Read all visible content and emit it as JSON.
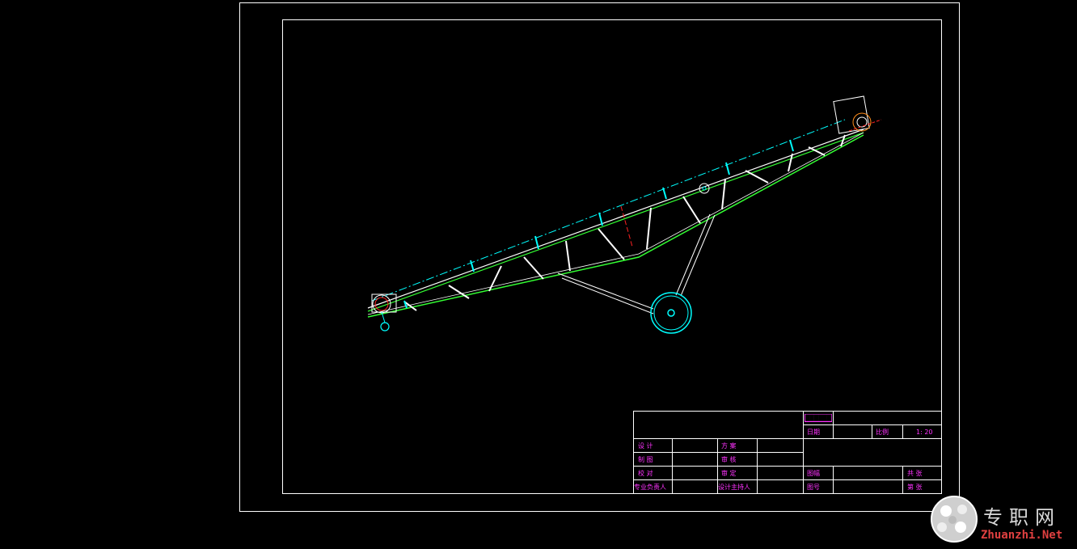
{
  "title_block": {
    "drawing_name": "██████",
    "date_label": "日期",
    "scale_label": "比例",
    "scale_value": "1: 20",
    "designer_label": "设 计",
    "drafter_label": "制 图",
    "checker_label": "校 对",
    "lead_label": "专业负责人",
    "scheme_label": "方 案",
    "review_label": "审 核",
    "approve_label": "审 定",
    "chief_label": "设计主持人",
    "drawing_no_label": "图幅",
    "sheet_label": "图号",
    "total_label": "共 张",
    "page_label": "第 张"
  },
  "watermark": {
    "chinese": "专职网",
    "english": "Zhuanzhi.Net"
  },
  "colors": {
    "background": "#000000",
    "frame": "#ffffff",
    "structure_green": "#33ff33",
    "structure_white": "#ffffff",
    "detail_cyan": "#00ffff",
    "centerline_red": "#ff2222",
    "text_magenta": "#ff33ff"
  }
}
